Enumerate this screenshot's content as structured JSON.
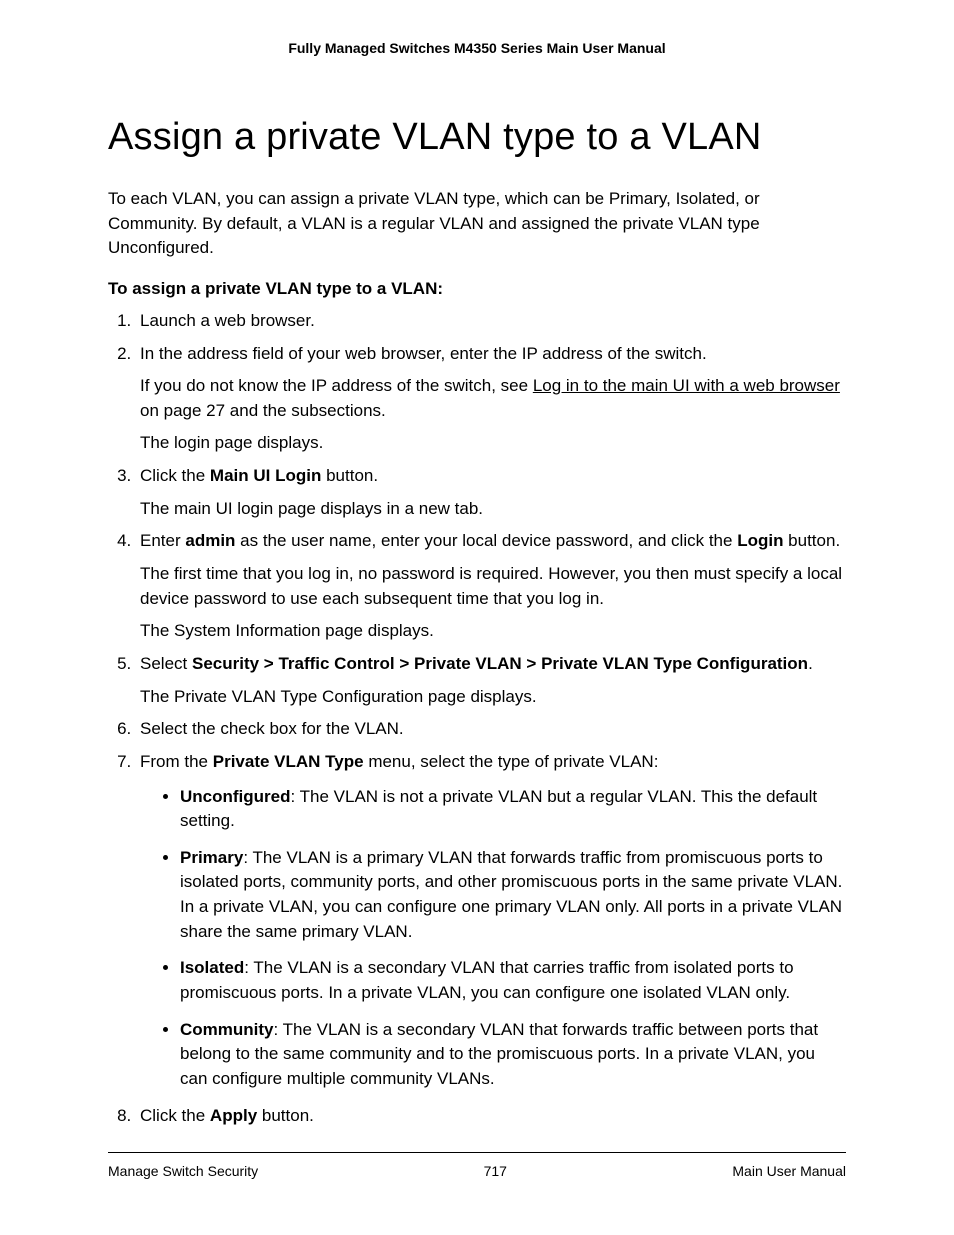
{
  "header": {
    "running": "Fully Managed Switches M4350 Series Main User Manual"
  },
  "title": "Assign a private VLAN type to a VLAN",
  "intro": "To each VLAN, you can assign a private VLAN type, which can be Primary, Isolated, or Community. By default, a VLAN is a regular VLAN and assigned the private VLAN type Unconfigured.",
  "subhead": "To assign a private VLAN type to a VLAN:",
  "steps": {
    "s1": "Launch a web browser.",
    "s2": {
      "lead": "In the address field of your web browser, enter the IP address of the switch.",
      "p1a": "If you do not know the IP address of the switch, see ",
      "p1link": "Log in to the main UI with a web browser",
      "p1b": " on page 27 and the subsections.",
      "p2": "The login page displays."
    },
    "s3": {
      "pre": "Click the ",
      "bold": "Main UI Login",
      "post": " button.",
      "p1": "The main UI login page displays in a new tab."
    },
    "s4": {
      "pre": "Enter ",
      "b1": "admin",
      "mid": " as the user name, enter your local device password, and click the ",
      "b2": "Login",
      "post": " button.",
      "p1": "The first time that you log in, no password is required. However, you then must specify a local device password to use each subsequent time that you log in.",
      "p2": "The System Information page displays."
    },
    "s5": {
      "pre": "Select ",
      "bold": "Security > Traffic Control > Private VLAN > Private VLAN Type Configuration",
      "post": ".",
      "p1": "The Private VLAN Type Configuration page displays."
    },
    "s6": "Select the check box for the VLAN.",
    "s7": {
      "pre": "From the ",
      "bold": "Private VLAN Type",
      "post": " menu, select the type of private VLAN:",
      "bullets": {
        "b1": {
          "label": "Unconfigured",
          "text": ": The VLAN is not a private VLAN but a regular VLAN. This the default setting."
        },
        "b2": {
          "label": "Primary",
          "text": ": The VLAN is a primary VLAN that forwards traffic from promiscuous ports to isolated ports, community ports, and other promiscuous ports in the same private VLAN. In a private VLAN, you can configure one primary VLAN only. All ports in a private VLAN share the same primary VLAN."
        },
        "b3": {
          "label": "Isolated",
          "text": ": The VLAN is a secondary VLAN that carries traffic from isolated ports to promiscuous ports. In a private VLAN, you can configure one isolated VLAN only."
        },
        "b4": {
          "label": "Community",
          "text": ": The VLAN is a secondary VLAN that forwards traffic between ports that belong to the same community and to the promiscuous ports. In a private VLAN, you can configure multiple community VLANs."
        }
      }
    },
    "s8": {
      "pre": "Click the ",
      "bold": "Apply",
      "post": " button."
    }
  },
  "footer": {
    "left": "Manage Switch Security",
    "center": "717",
    "right": "Main User Manual"
  }
}
